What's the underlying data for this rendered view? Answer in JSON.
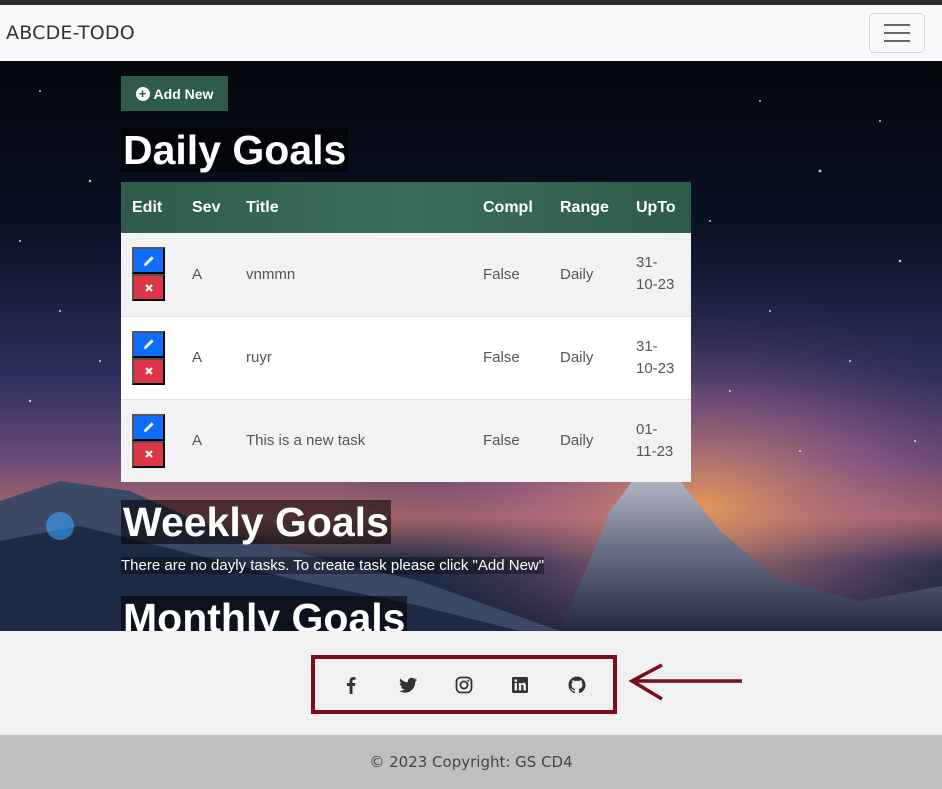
{
  "navbar": {
    "brand": "ABCDE-TODO",
    "menu_icon": "hamburger-icon"
  },
  "main": {
    "add_button_label": "Add New",
    "daily": {
      "title": "Daily Goals",
      "columns": [
        "Edit",
        "Sev",
        "Title",
        "Compl",
        "Range",
        "UpTo"
      ],
      "rows": [
        {
          "sev": "A",
          "title": "vnmmn",
          "compl": "False",
          "range": "Daily",
          "upto_a": "31-",
          "upto_b": "10-23"
        },
        {
          "sev": "A",
          "title": "ruyr",
          "compl": "False",
          "range": "Daily",
          "upto_a": "31-",
          "upto_b": "10-23"
        },
        {
          "sev": "A",
          "title": "This is a new task",
          "compl": "False",
          "range": "Daily",
          "upto_a": "01-",
          "upto_b": "11-23"
        }
      ]
    },
    "weekly": {
      "title": "Weekly Goals",
      "empty_message": "There are no dayly tasks. To create task please click \"Add New\""
    },
    "monthly": {
      "title": "Monthly Goals"
    }
  },
  "social": {
    "icons": [
      "facebook-icon",
      "twitter-icon",
      "instagram-icon",
      "linkedin-icon",
      "github-icon"
    ],
    "annotation_color": "#7a0d1a"
  },
  "footer": {
    "copyright": "© 2023 Copyright: GS CD4"
  },
  "colors": {
    "header_green": "#2f5b4a",
    "edit_blue": "#0d6efd",
    "delete_red": "#dc3545"
  }
}
